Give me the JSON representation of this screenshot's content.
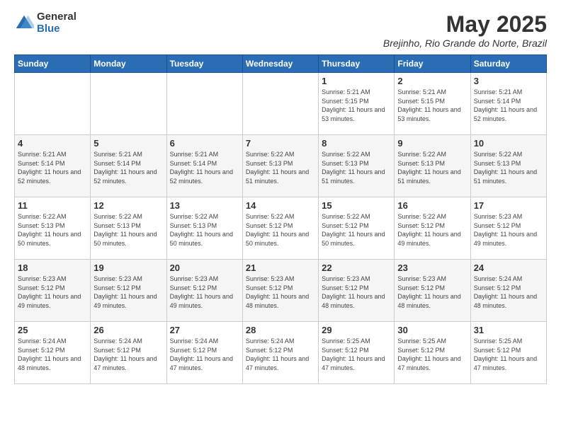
{
  "logo": {
    "general": "General",
    "blue": "Blue"
  },
  "header": {
    "month": "May 2025",
    "location": "Brejinho, Rio Grande do Norte, Brazil"
  },
  "days_of_week": [
    "Sunday",
    "Monday",
    "Tuesday",
    "Wednesday",
    "Thursday",
    "Friday",
    "Saturday"
  ],
  "weeks": [
    [
      {
        "day": "",
        "sunrise": "",
        "sunset": "",
        "daylight": ""
      },
      {
        "day": "",
        "sunrise": "",
        "sunset": "",
        "daylight": ""
      },
      {
        "day": "",
        "sunrise": "",
        "sunset": "",
        "daylight": ""
      },
      {
        "day": "",
        "sunrise": "",
        "sunset": "",
        "daylight": ""
      },
      {
        "day": "1",
        "sunrise": "5:21 AM",
        "sunset": "5:15 PM",
        "daylight": "11 hours and 53 minutes."
      },
      {
        "day": "2",
        "sunrise": "5:21 AM",
        "sunset": "5:15 PM",
        "daylight": "11 hours and 53 minutes."
      },
      {
        "day": "3",
        "sunrise": "5:21 AM",
        "sunset": "5:14 PM",
        "daylight": "11 hours and 52 minutes."
      }
    ],
    [
      {
        "day": "4",
        "sunrise": "5:21 AM",
        "sunset": "5:14 PM",
        "daylight": "11 hours and 52 minutes."
      },
      {
        "day": "5",
        "sunrise": "5:21 AM",
        "sunset": "5:14 PM",
        "daylight": "11 hours and 52 minutes."
      },
      {
        "day": "6",
        "sunrise": "5:21 AM",
        "sunset": "5:14 PM",
        "daylight": "11 hours and 52 minutes."
      },
      {
        "day": "7",
        "sunrise": "5:22 AM",
        "sunset": "5:13 PM",
        "daylight": "11 hours and 51 minutes."
      },
      {
        "day": "8",
        "sunrise": "5:22 AM",
        "sunset": "5:13 PM",
        "daylight": "11 hours and 51 minutes."
      },
      {
        "day": "9",
        "sunrise": "5:22 AM",
        "sunset": "5:13 PM",
        "daylight": "11 hours and 51 minutes."
      },
      {
        "day": "10",
        "sunrise": "5:22 AM",
        "sunset": "5:13 PM",
        "daylight": "11 hours and 51 minutes."
      }
    ],
    [
      {
        "day": "11",
        "sunrise": "5:22 AM",
        "sunset": "5:13 PM",
        "daylight": "11 hours and 50 minutes."
      },
      {
        "day": "12",
        "sunrise": "5:22 AM",
        "sunset": "5:13 PM",
        "daylight": "11 hours and 50 minutes."
      },
      {
        "day": "13",
        "sunrise": "5:22 AM",
        "sunset": "5:13 PM",
        "daylight": "11 hours and 50 minutes."
      },
      {
        "day": "14",
        "sunrise": "5:22 AM",
        "sunset": "5:12 PM",
        "daylight": "11 hours and 50 minutes."
      },
      {
        "day": "15",
        "sunrise": "5:22 AM",
        "sunset": "5:12 PM",
        "daylight": "11 hours and 50 minutes."
      },
      {
        "day": "16",
        "sunrise": "5:22 AM",
        "sunset": "5:12 PM",
        "daylight": "11 hours and 49 minutes."
      },
      {
        "day": "17",
        "sunrise": "5:23 AM",
        "sunset": "5:12 PM",
        "daylight": "11 hours and 49 minutes."
      }
    ],
    [
      {
        "day": "18",
        "sunrise": "5:23 AM",
        "sunset": "5:12 PM",
        "daylight": "11 hours and 49 minutes."
      },
      {
        "day": "19",
        "sunrise": "5:23 AM",
        "sunset": "5:12 PM",
        "daylight": "11 hours and 49 minutes."
      },
      {
        "day": "20",
        "sunrise": "5:23 AM",
        "sunset": "5:12 PM",
        "daylight": "11 hours and 49 minutes."
      },
      {
        "day": "21",
        "sunrise": "5:23 AM",
        "sunset": "5:12 PM",
        "daylight": "11 hours and 48 minutes."
      },
      {
        "day": "22",
        "sunrise": "5:23 AM",
        "sunset": "5:12 PM",
        "daylight": "11 hours and 48 minutes."
      },
      {
        "day": "23",
        "sunrise": "5:23 AM",
        "sunset": "5:12 PM",
        "daylight": "11 hours and 48 minutes."
      },
      {
        "day": "24",
        "sunrise": "5:24 AM",
        "sunset": "5:12 PM",
        "daylight": "11 hours and 48 minutes."
      }
    ],
    [
      {
        "day": "25",
        "sunrise": "5:24 AM",
        "sunset": "5:12 PM",
        "daylight": "11 hours and 48 minutes."
      },
      {
        "day": "26",
        "sunrise": "5:24 AM",
        "sunset": "5:12 PM",
        "daylight": "11 hours and 47 minutes."
      },
      {
        "day": "27",
        "sunrise": "5:24 AM",
        "sunset": "5:12 PM",
        "daylight": "11 hours and 47 minutes."
      },
      {
        "day": "28",
        "sunrise": "5:24 AM",
        "sunset": "5:12 PM",
        "daylight": "11 hours and 47 minutes."
      },
      {
        "day": "29",
        "sunrise": "5:25 AM",
        "sunset": "5:12 PM",
        "daylight": "11 hours and 47 minutes."
      },
      {
        "day": "30",
        "sunrise": "5:25 AM",
        "sunset": "5:12 PM",
        "daylight": "11 hours and 47 minutes."
      },
      {
        "day": "31",
        "sunrise": "5:25 AM",
        "sunset": "5:12 PM",
        "daylight": "11 hours and 47 minutes."
      }
    ]
  ]
}
